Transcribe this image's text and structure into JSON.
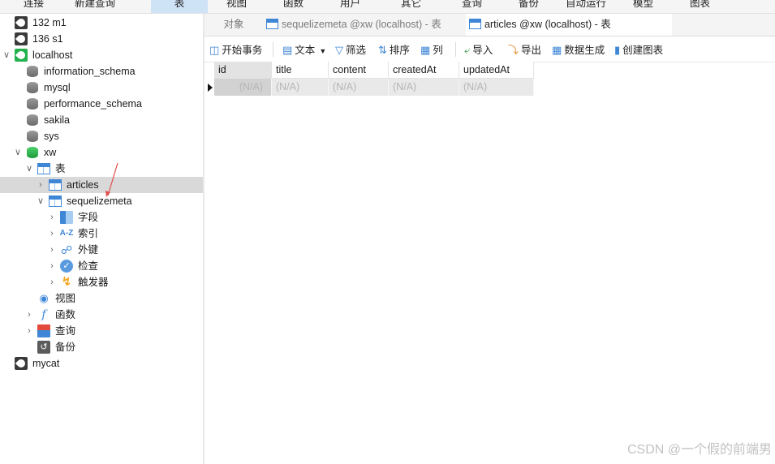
{
  "menu": [
    {
      "label": "连接"
    },
    {
      "label": "新建查询"
    },
    {
      "label": "表"
    },
    {
      "label": "视图"
    },
    {
      "label": "函数"
    },
    {
      "label": "用户"
    },
    {
      "label": "其它"
    },
    {
      "label": "查询"
    },
    {
      "label": "备份"
    },
    {
      "label": "自动运行"
    },
    {
      "label": "模型"
    },
    {
      "label": "图表"
    }
  ],
  "tree": {
    "conn1": "132 m1",
    "conn2": "136 s1",
    "conn3": "localhost",
    "db1": "information_schema",
    "db2": "mysql",
    "db3": "performance_schema",
    "db4": "sakila",
    "db5": "sys",
    "db6": "xw",
    "tables": "表",
    "table1": "articles",
    "table2": "sequelizemeta",
    "fields": "字段",
    "indexes": "索引",
    "foreign_keys": "外键",
    "checks": "检查",
    "triggers": "触发器",
    "views": "视图",
    "functions": "函数",
    "queries": "查询",
    "backups": "备份",
    "conn4": "mycat",
    "index_icon_text": "A-Z"
  },
  "tabs": {
    "objects": "对象",
    "tab1": "sequelizemeta @xw (localhost) - 表",
    "tab2": "articles @xw (localhost) - 表"
  },
  "toolbar": {
    "begin_tx": "开始事务",
    "text": "文本",
    "filter": "筛选",
    "sort": "排序",
    "columns": "列",
    "import": "导入",
    "export": "导出",
    "generate": "数据生成",
    "chart": "创建图表"
  },
  "grid": {
    "columns": [
      "id",
      "title",
      "content",
      "createdAt",
      "updatedAt"
    ],
    "row": [
      "(N/A)",
      "(N/A)",
      "(N/A)",
      "(N/A)",
      "(N/A)"
    ]
  },
  "watermark": "CSDN @一个假的前端男",
  "colors": {
    "accent": "#3f86d6",
    "selected_tab": "#cfe3f7",
    "connection_active": "#22b14c"
  }
}
